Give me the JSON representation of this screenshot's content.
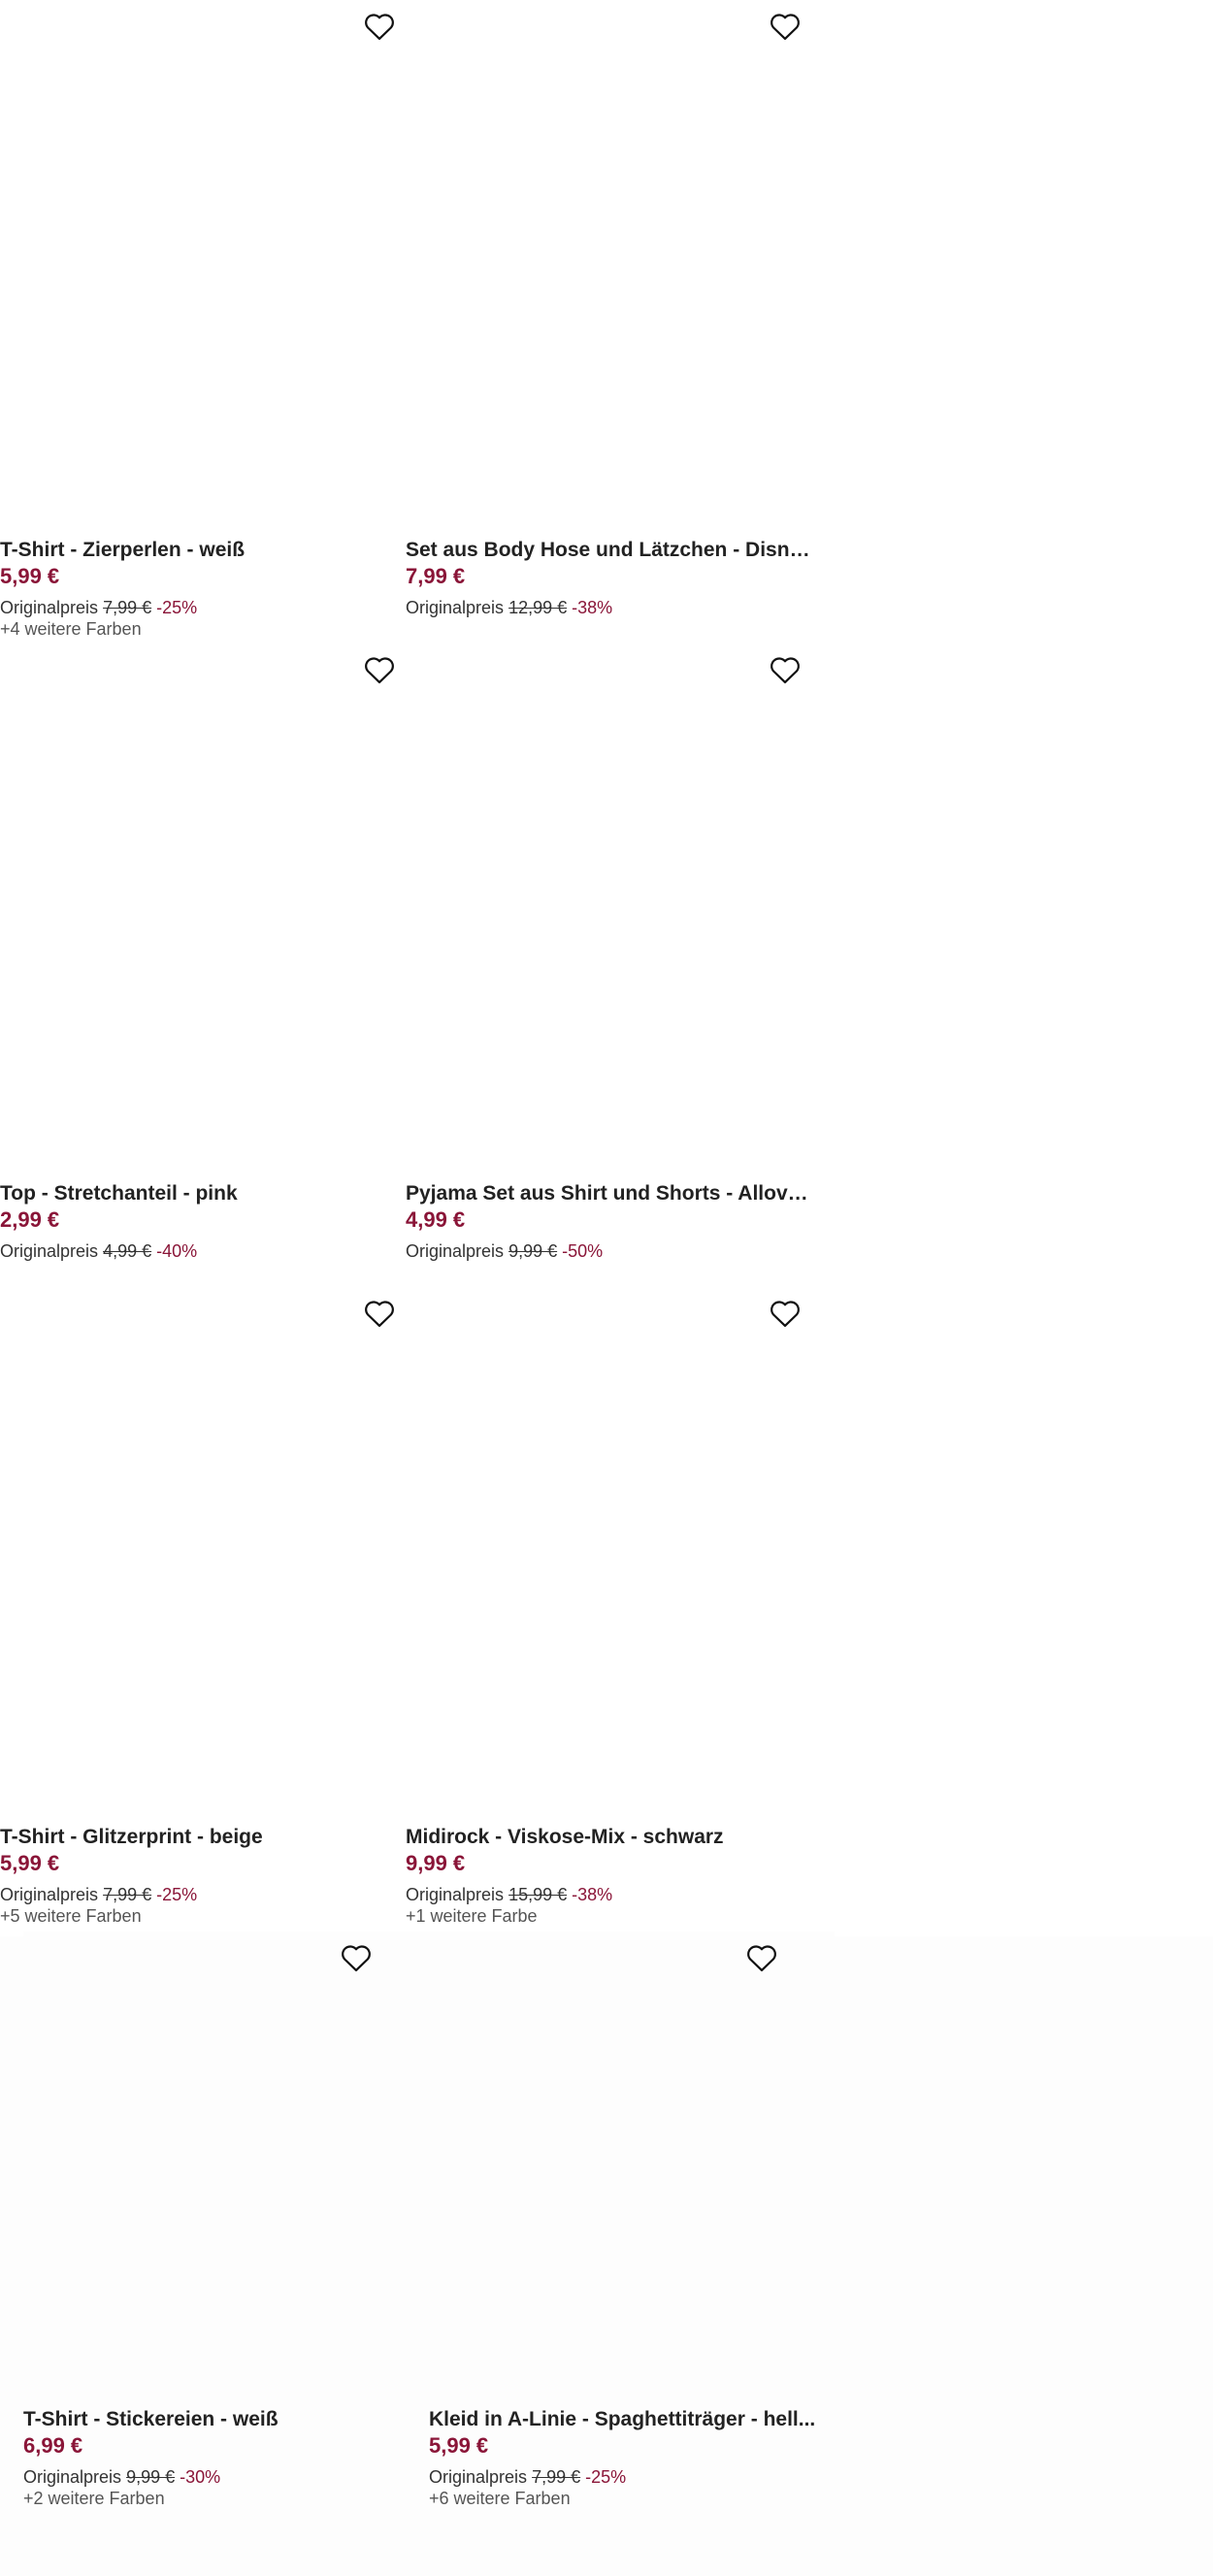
{
  "accent_color": "#8a1538",
  "products": [
    {
      "title": "T-Shirt - Zierperlen - weiß",
      "price": "5,99 €",
      "orig_label": "Originalpreis",
      "orig_price": "7,99 €",
      "discount": "-25%",
      "colors": "+4 weitere Farben",
      "wishlist_icon": "heart-outline-icon"
    },
    {
      "title": "Set aus Body Hose und Lätzchen - Disney - ...",
      "price": "7,99 €",
      "orig_label": "Originalpreis",
      "orig_price": "12,99 €",
      "discount": "-38%",
      "colors": "",
      "wishlist_icon": "heart-outline-icon"
    },
    {
      "title": "Top - Stretchanteil - pink",
      "price": "2,99 €",
      "orig_label": "Originalpreis",
      "orig_price": "4,99 €",
      "discount": "-40%",
      "colors": "",
      "wishlist_icon": "heart-outline-icon"
    },
    {
      "title": "Pyjama Set aus Shirt und Shorts - Allover-M...",
      "price": "4,99 €",
      "orig_label": "Originalpreis",
      "orig_price": "9,99 €",
      "discount": "-50%",
      "colors": "",
      "wishlist_icon": "heart-outline-icon"
    },
    {
      "title": "T-Shirt - Glitzerprint - beige",
      "price": "5,99 €",
      "orig_label": "Originalpreis",
      "orig_price": "7,99 €",
      "discount": "-25%",
      "colors": "+5 weitere Farben",
      "wishlist_icon": "heart-outline-icon"
    },
    {
      "title": "Midirock - Viskose-Mix - schwarz",
      "price": "9,99 €",
      "orig_label": "Originalpreis",
      "orig_price": "15,99 €",
      "discount": "-38%",
      "colors": "+1 weitere Farbe",
      "wishlist_icon": "heart-outline-icon"
    },
    {
      "title": "T-Shirt - Stickereien - weiß",
      "price": "6,99 €",
      "orig_label": "Originalpreis",
      "orig_price": "9,99 €",
      "discount": "-30%",
      "colors": "+2 weitere Farben",
      "wishlist_icon": "heart-outline-icon"
    },
    {
      "title": "Kleid in A-Linie - Spaghettiträger - hell...",
      "price": "5,99 €",
      "orig_label": "Originalpreis",
      "orig_price": "7,99 €",
      "discount": "-25%",
      "colors": "+6 weitere Farben",
      "wishlist_icon": "heart-outline-icon"
    }
  ]
}
